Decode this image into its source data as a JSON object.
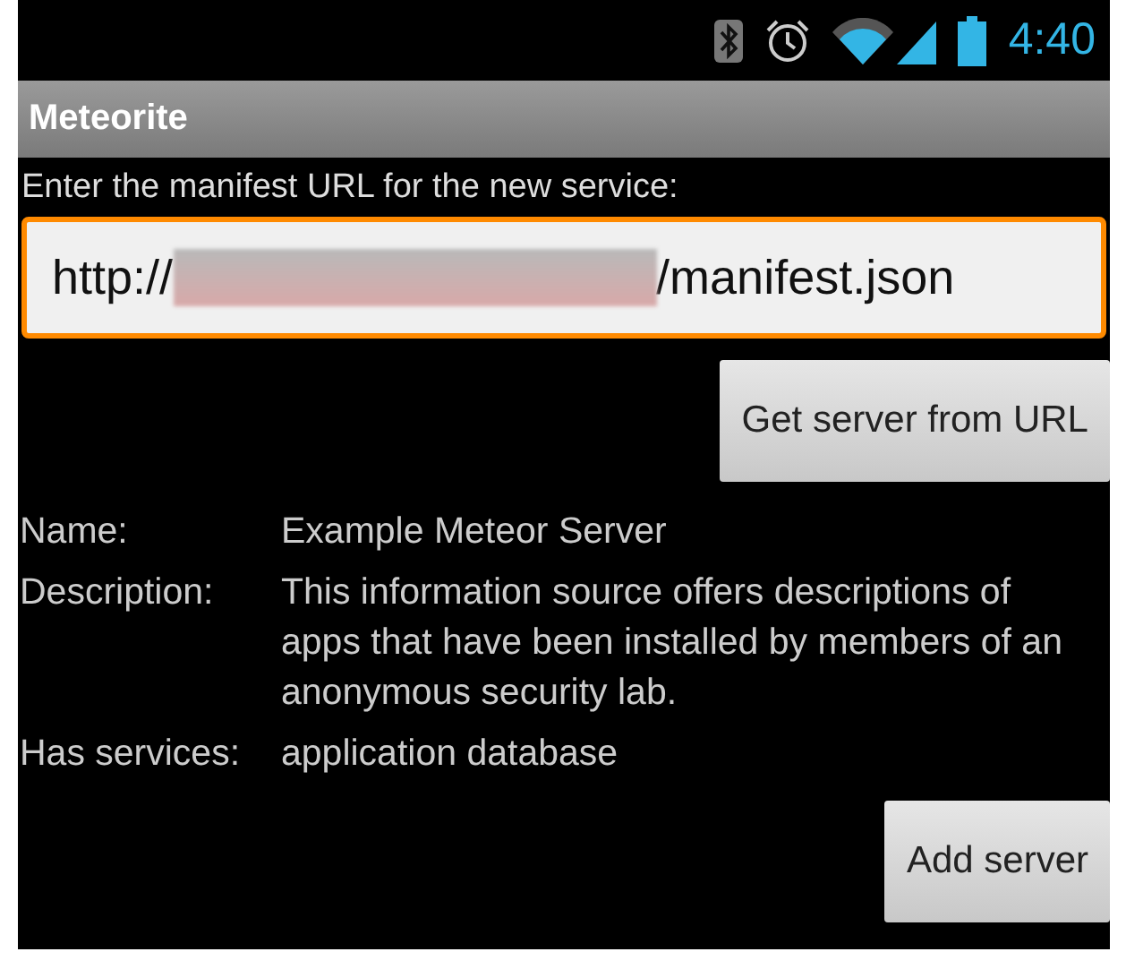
{
  "status_bar": {
    "time": "4:40"
  },
  "action_bar": {
    "title": "Meteorite"
  },
  "prompt": "Enter the manifest URL for the new service:",
  "url_field": {
    "prefix": "http://",
    "suffix": "/manifest.json",
    "redacted": true,
    "focused": true
  },
  "fetch_button": "Get server from URL",
  "details": [
    {
      "label": "Name:",
      "value": "Example Meteor Server"
    },
    {
      "label": "Description:",
      "value": "This information source offers descriptions of apps that have been installed by members of an anonymous security lab."
    },
    {
      "label": "Has services:",
      "value": "application database"
    }
  ],
  "add_button": "Add server"
}
